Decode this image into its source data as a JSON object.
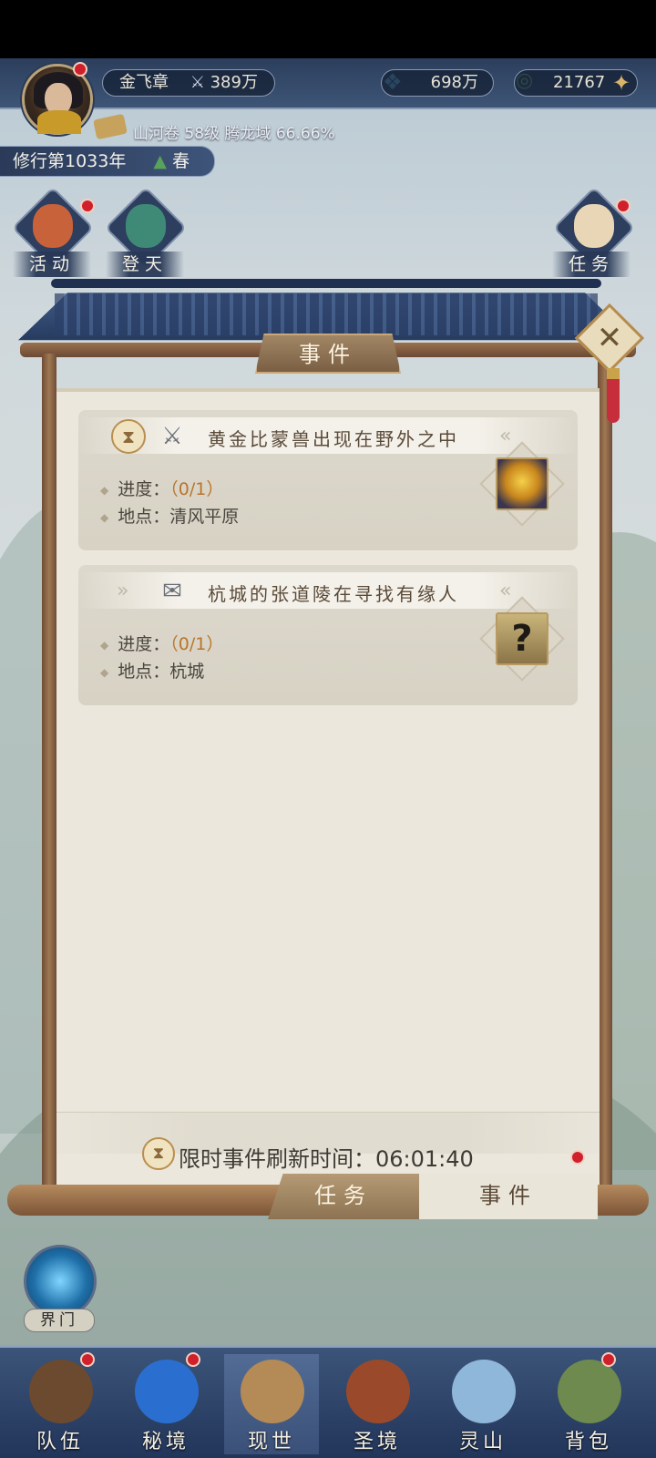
{
  "header": {
    "player_name": "金飞章",
    "power": "389万",
    "jade": "698万",
    "coins": "21767",
    "realm_info": "山河卷 58级 腾龙域 66.66%",
    "year": "修行第1033年",
    "season": "春"
  },
  "side_buttons": {
    "activity": "活动",
    "ascend": "登天",
    "tasks": "任务"
  },
  "modal": {
    "title": "事件",
    "events": [
      {
        "title": "黄金比蒙兽出现在野外之中",
        "progress_label": "进度：",
        "progress_value": "（0/1）",
        "location_label": "地点：",
        "location_value": "清风平原"
      },
      {
        "title": "杭城的张道陵在寻找有缘人",
        "progress_label": "进度：",
        "progress_value": "（0/1）",
        "location_label": "地点：",
        "location_value": "杭城"
      }
    ],
    "refresh_label": "限时事件刷新时间：06:01:40",
    "tabs": {
      "tasks": "任务",
      "events": "事件"
    }
  },
  "gate_label": "界门",
  "bottom_nav": [
    {
      "label": "队伍",
      "color": "#6b4a30"
    },
    {
      "label": "秘境",
      "color": "#2a6fd0"
    },
    {
      "label": "现世",
      "color": "#b48a56"
    },
    {
      "label": "圣境",
      "color": "#9a4a2a"
    },
    {
      "label": "灵山",
      "color": "#8fb7d9"
    },
    {
      "label": "背包",
      "color": "#6e8a4e"
    }
  ]
}
